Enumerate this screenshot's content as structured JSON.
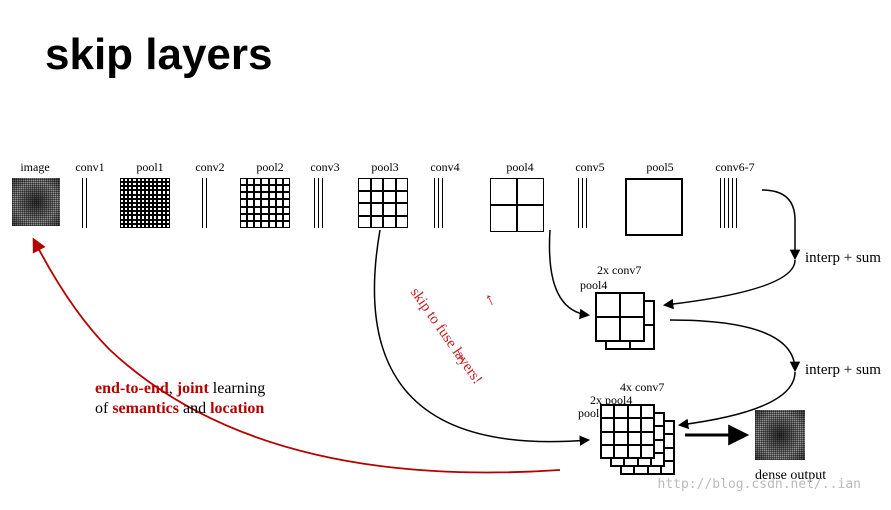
{
  "title": "skip layers",
  "layers": {
    "image": "image",
    "conv1": "conv1",
    "pool1": "pool1",
    "conv2": "conv2",
    "pool2": "pool2",
    "conv3": "conv3",
    "pool3": "pool3",
    "conv4": "conv4",
    "pool4": "pool4",
    "conv5": "conv5",
    "pool5": "pool5",
    "conv67": "conv6-7"
  },
  "op1": "interp + sum",
  "op2": "interp + sum",
  "fuse1": {
    "top": "2x conv7",
    "bottom": "pool4"
  },
  "fuse2": {
    "top": "4x conv7",
    "mid": "2x pool4",
    "bottom": "pool3"
  },
  "skip_text": "skip to fuse layers!",
  "caption": {
    "l1a": "end-to-end",
    "l1b": ", ",
    "l1c": "joint",
    "l1d": " learning",
    "l2a": "of ",
    "l2b": "semantics",
    "l2c": " and ",
    "l2d": "location"
  },
  "output": "dense output",
  "watermark": "http://blog.csdn.net/..ian"
}
